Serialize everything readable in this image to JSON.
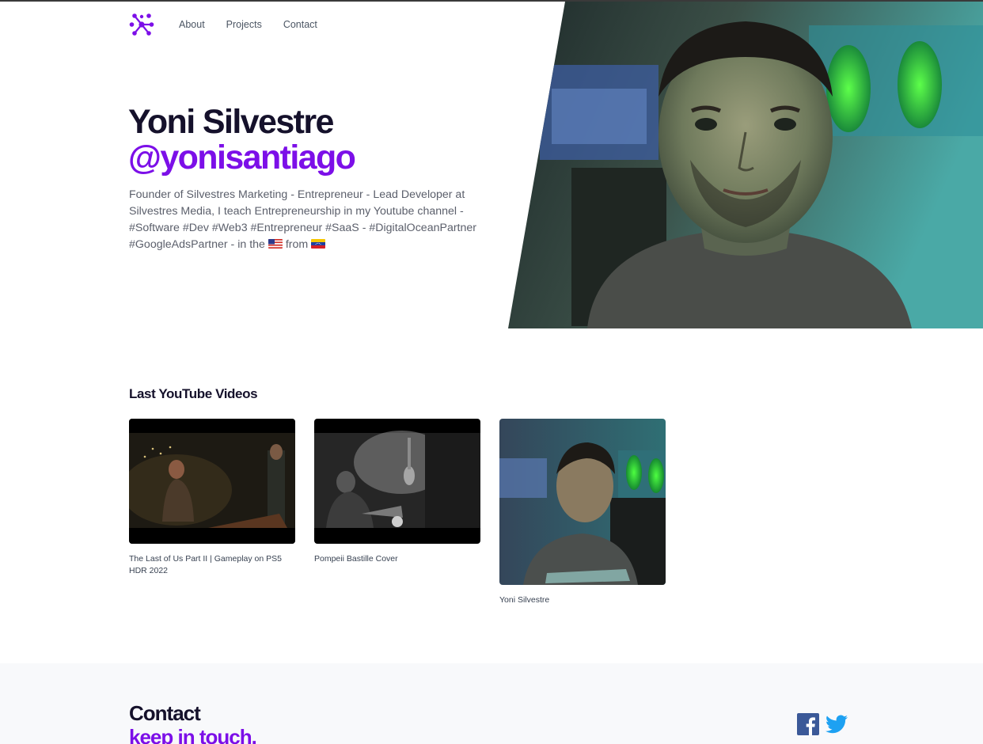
{
  "header": {
    "logo_icon": "network-dots-logo-icon",
    "nav": [
      {
        "label": "About"
      },
      {
        "label": "Projects"
      },
      {
        "label": "Contact"
      }
    ]
  },
  "hero": {
    "name": "Yoni Silvestre",
    "handle": "@yonisantiago",
    "bio": "Founder of Silvestres Marketing - Entrepreneur - Lead Developer at Silvestres Media, I teach Entrepreneurship in my Youtube channel - #Software #Dev #Web3 #Entrepreneur #SaaS - #DigitalOceanPartner #GoogleAdsPartner - in the",
    "bio_from": "from",
    "flags": [
      "us-flag-icon",
      "venezuela-flag-icon"
    ],
    "photo_icon": "profile-photo"
  },
  "videos": {
    "title": "Last YouTube Videos",
    "items": [
      {
        "title": "The Last of Us Part II | Gameplay on PS5 HDR 2022"
      },
      {
        "title": "Pompeii Bastille Cover"
      },
      {
        "title": "Yoni Silvestre"
      }
    ]
  },
  "contact": {
    "title": "Contact",
    "subtitle": "keep in touch.",
    "social": [
      "facebook-icon",
      "twitter-icon"
    ]
  },
  "colors": {
    "accent": "#7c0fe8",
    "heading": "#15112b",
    "body_text": "#5b5f6b",
    "facebook": "#3b5998",
    "twitter": "#1da1f2"
  }
}
